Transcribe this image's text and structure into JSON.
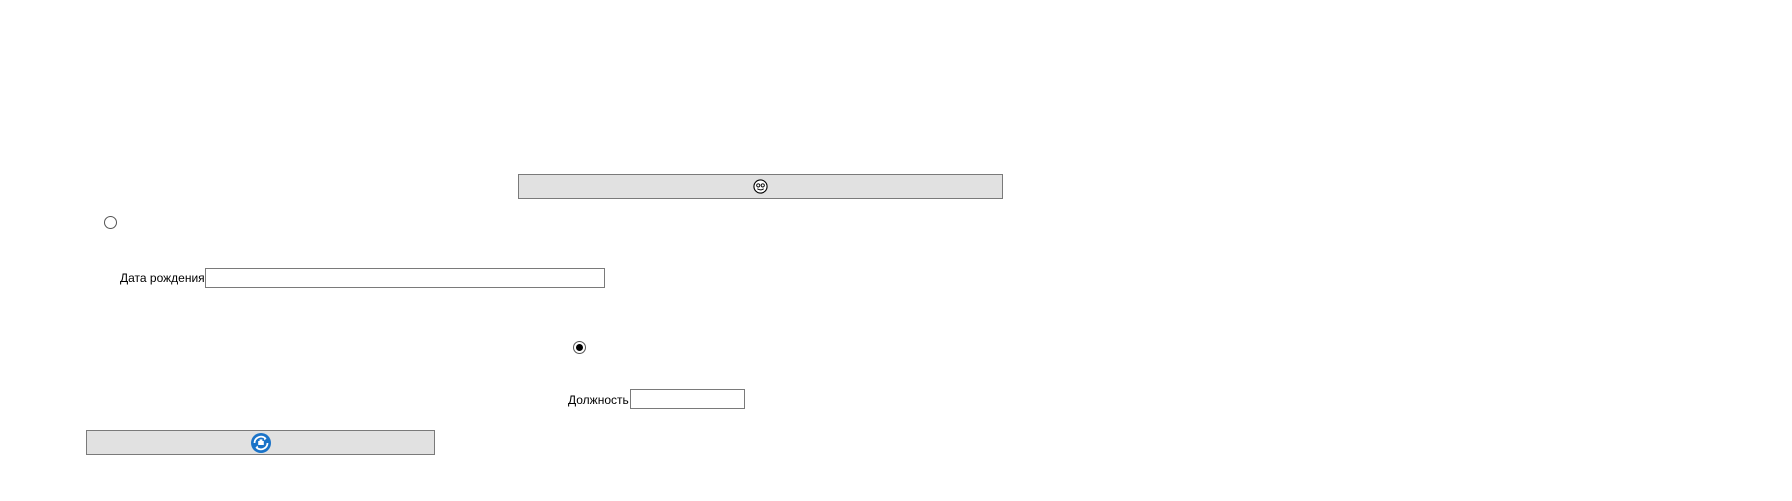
{
  "top_button": {
    "icon": "smiley-face-icon",
    "label": ""
  },
  "radio_1": {
    "checked": false
  },
  "birth_date": {
    "label": "Дата рождения",
    "value": "",
    "placeholder": ""
  },
  "radio_2": {
    "checked": true
  },
  "position": {
    "label": "Должность",
    "value": "",
    "placeholder": ""
  },
  "bottom_button": {
    "icon": "sync-globe-icon",
    "label": "",
    "icon_color": "#1a73c8"
  }
}
